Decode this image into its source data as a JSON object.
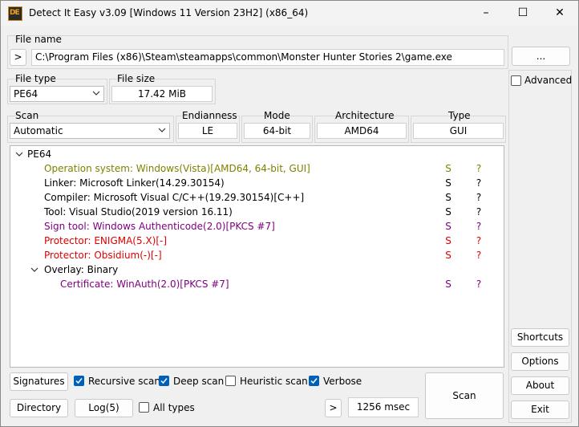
{
  "window": {
    "title": "Detect It Easy v3.09 [Windows 11 Version 23H2] (x86_64)",
    "controls": {
      "minimize": "–",
      "maximize": "☐",
      "close": "✕"
    }
  },
  "file_name": {
    "label": "File name",
    "expand_button": ">",
    "path": "C:\\Program Files (x86)\\Steam\\steamapps\\common\\Monster Hunter Stories 2\\game.exe",
    "browse_button": "..."
  },
  "file_type": {
    "label": "File type",
    "value": "PE64"
  },
  "file_size": {
    "label": "File size",
    "value": "17.42 MiB"
  },
  "advanced": {
    "label": "Advanced",
    "checked": false
  },
  "scan": {
    "label": "Scan",
    "value": "Automatic"
  },
  "endianness": {
    "label": "Endianness",
    "value": "LE"
  },
  "mode": {
    "label": "Mode",
    "value": "64-bit"
  },
  "architecture": {
    "label": "Architecture",
    "value": "AMD64"
  },
  "type": {
    "label": "Type",
    "value": "GUI"
  },
  "tree": {
    "root": "PE64",
    "rows": [
      {
        "text": "Operation system: Windows(Vista)[AMD64, 64-bit, GUI]",
        "flag": "S",
        "q": "?",
        "color": "#808000"
      },
      {
        "text": "Linker: Microsoft Linker(14.29.30154)",
        "flag": "S",
        "q": "?",
        "color": "#000000"
      },
      {
        "text": "Compiler: Microsoft Visual C/C++(19.29.30154)[C++]",
        "flag": "S",
        "q": "?",
        "color": "#000000"
      },
      {
        "text": "Tool: Visual Studio(2019 version 16.11)",
        "flag": "S",
        "q": "?",
        "color": "#000000"
      },
      {
        "text": "Sign tool: Windows Authenticode(2.0)[PKCS #7]",
        "flag": "S",
        "q": "?",
        "color": "#800080"
      },
      {
        "text": "Protector: ENIGMA(5.X)[-]",
        "flag": "S",
        "q": "?",
        "color": "#e00000"
      },
      {
        "text": "Protector: Obsidium(-)[-]",
        "flag": "S",
        "q": "?",
        "color": "#e00000"
      }
    ],
    "overlay": "Overlay: Binary",
    "certificate": {
      "text": "Certificate: WinAuth(2.0)[PKCS #7]",
      "flag": "S",
      "q": "?",
      "color": "#800080"
    }
  },
  "side_buttons": {
    "shortcuts": "Shortcuts",
    "options": "Options",
    "about": "About",
    "exit": "Exit"
  },
  "bottom": {
    "signatures": "Signatures",
    "recursive_scan": {
      "label": "Recursive scan",
      "checked": true
    },
    "deep_scan": {
      "label": "Deep scan",
      "checked": true
    },
    "heuristic_scan": {
      "label": "Heuristic scan",
      "checked": false
    },
    "verbose": {
      "label": "Verbose",
      "checked": true
    },
    "directory": "Directory",
    "log": "Log(5)",
    "all_types": {
      "label": "All types",
      "checked": false
    },
    "expand_button": ">",
    "elapsed": "1256 msec",
    "scan_button": "Scan"
  },
  "colors": {
    "accent": "#005fb8",
    "olive": "#808000",
    "purple": "#800080",
    "red": "#e00000"
  }
}
